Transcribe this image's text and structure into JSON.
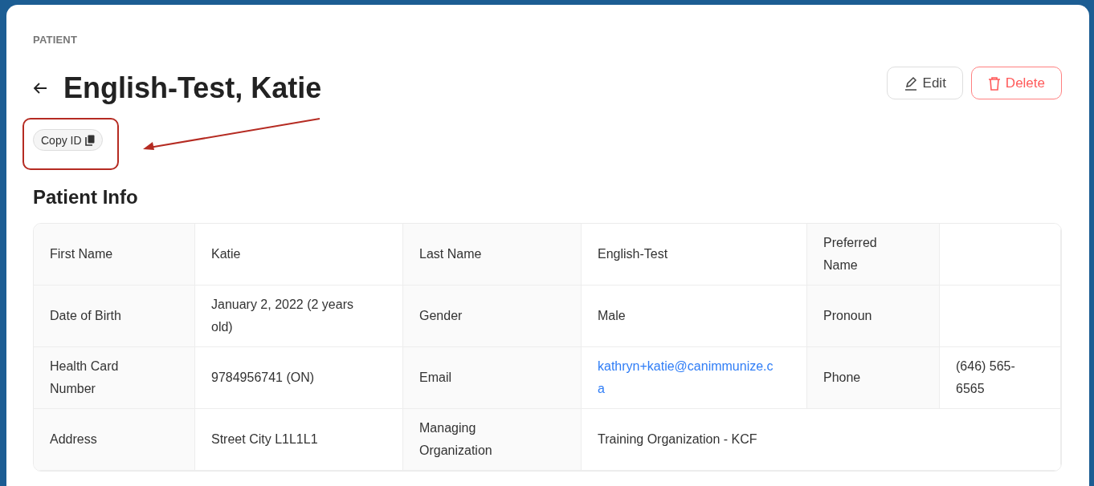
{
  "section_label": "PATIENT",
  "title": "English-Test, Katie",
  "actions": [
    {
      "kind": "edit",
      "label": "Edit"
    },
    {
      "kind": "delete",
      "label": "Delete"
    }
  ],
  "copy_id": {
    "label": "Copy ID"
  },
  "annotation": {
    "kind": "arrow-box"
  },
  "info_heading": "Patient Info",
  "rows": [
    {
      "cells": [
        {
          "kind": "label",
          "text": "First Name"
        },
        {
          "kind": "value",
          "text": "Katie"
        },
        {
          "kind": "label",
          "text": "Last Name"
        },
        {
          "kind": "value",
          "text": "English-Test"
        },
        {
          "kind": "label",
          "text": "Preferred Name"
        },
        {
          "kind": "value"
        }
      ]
    },
    {
      "cells": [
        {
          "kind": "label",
          "text": "Date of Birth"
        },
        {
          "kind": "value",
          "text": "January 2, 2022 (2 years old)"
        },
        {
          "kind": "label",
          "text": "Gender"
        },
        {
          "kind": "value",
          "text": "Male"
        },
        {
          "kind": "label",
          "text": "Pronoun"
        },
        {
          "kind": "value"
        }
      ]
    },
    {
      "cells": [
        {
          "kind": "label",
          "text": "Health Card Number"
        },
        {
          "kind": "value",
          "text": "9784956741 (ON)"
        },
        {
          "kind": "label",
          "text": "Email"
        },
        {
          "kind": "link",
          "text": "kathryn+katie@canimmunize.ca"
        },
        {
          "kind": "label",
          "text": "Phone"
        },
        {
          "kind": "value",
          "text": "(646) 565-6565"
        }
      ]
    },
    {
      "cells": [
        {
          "kind": "label",
          "text": "Address"
        },
        {
          "kind": "value",
          "text": "Street City L1L1L1"
        },
        {
          "kind": "label",
          "text": "Managing Organization"
        },
        {
          "kind": "value",
          "text": "Training Organization - KCF"
        }
      ]
    }
  ]
}
